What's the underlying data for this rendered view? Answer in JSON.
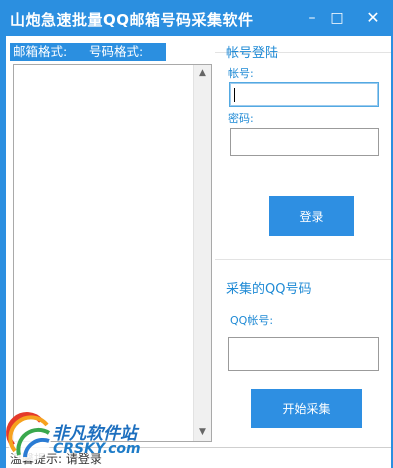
{
  "window": {
    "title": "山炮急速批量QQ邮箱号码采集软件",
    "minimize_glyph": "–",
    "maximize_glyph": "□",
    "close_glyph": "✕"
  },
  "tabs": [
    {
      "label": "邮箱格式:"
    },
    {
      "label": "号码格式:"
    }
  ],
  "login": {
    "section_title": "帐号登陆",
    "account_label": "帐号:",
    "account_value": "",
    "password_label": "密码:",
    "password_value": "",
    "login_button": "登录"
  },
  "collect": {
    "section_title": "采集的QQ号码",
    "qq_label": "QQ帐号:",
    "qq_value": "",
    "start_button": "开始采集"
  },
  "status": {
    "text": "温馨提示: 请登录"
  },
  "watermark": {
    "name": "非凡软件站",
    "url": "CRSKY.com"
  },
  "colors": {
    "accent": "#2b8fe0",
    "label": "#1f8ad5"
  },
  "icons": {
    "scroll_up": "scroll-up-arrow-icon",
    "scroll_down": "scroll-down-arrow-icon",
    "logo": "crsky-logo-icon"
  }
}
